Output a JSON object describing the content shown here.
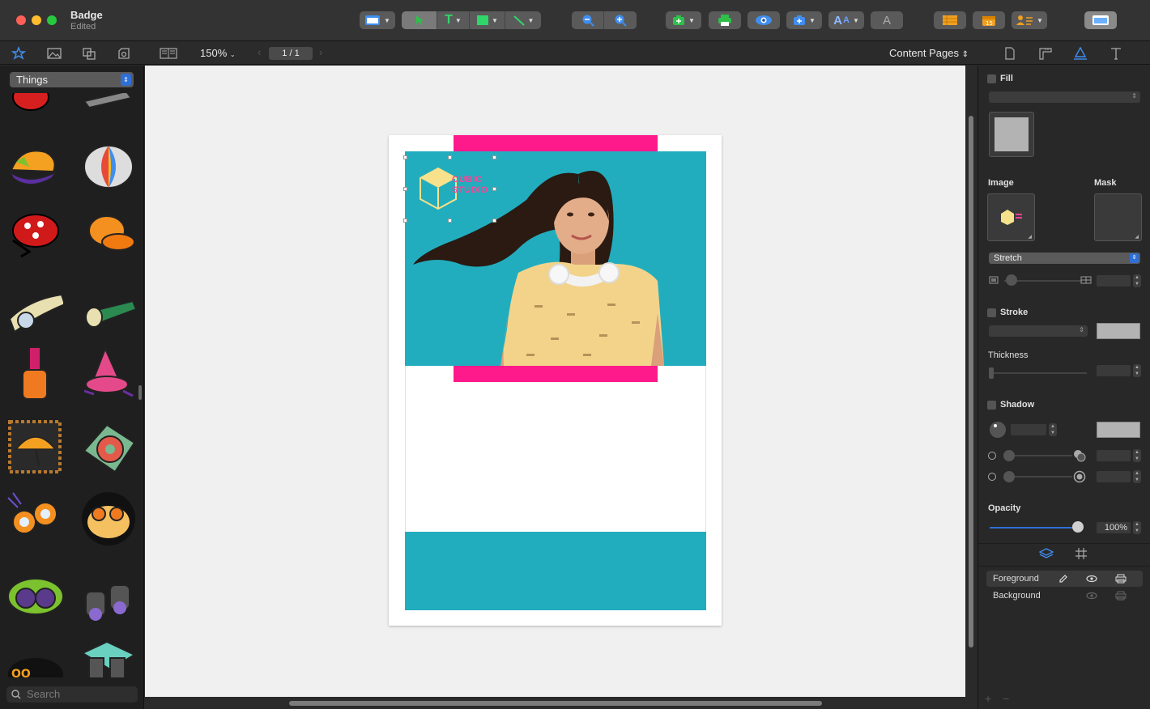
{
  "window": {
    "title": "Badge",
    "subtitle": "Edited"
  },
  "toolbar": {
    "zoom": "150%",
    "page_indicator": "1 / 1",
    "page_mode": "Content Pages",
    "icons": [
      "layout-icon",
      "select-arrow-icon",
      "text-tool-icon",
      "shape-tool-icon",
      "line-tool-icon",
      "zoom-out-icon",
      "zoom-in-icon",
      "insert-icon",
      "print-icon",
      "preview-eye-icon",
      "placeholder-icon",
      "font-icon",
      "text-style-icon",
      "list-icon",
      "calendar-icon",
      "contact-icon",
      "sidebar-icon"
    ]
  },
  "library": {
    "category": "Things",
    "search_placeholder": "Search",
    "tabs": [
      "clipart-icon",
      "image-icon",
      "shapes-icon",
      "photo-icon"
    ]
  },
  "document": {
    "logo_line1": "CUBIC",
    "logo_line2": "STUDIO",
    "colors": {
      "pink": "#ff1a8c",
      "teal": "#22adbe"
    }
  },
  "inspector": {
    "fill_label": "Fill",
    "image_label": "Image",
    "mask_label": "Mask",
    "stretch_option": "Stretch",
    "stroke_label": "Stroke",
    "thickness_label": "Thickness",
    "shadow_label": "Shadow",
    "opacity_label": "Opacity",
    "opacity_value": "100%",
    "opacity": 1.0,
    "layers": [
      {
        "name": "Foreground"
      },
      {
        "name": "Background"
      }
    ]
  }
}
